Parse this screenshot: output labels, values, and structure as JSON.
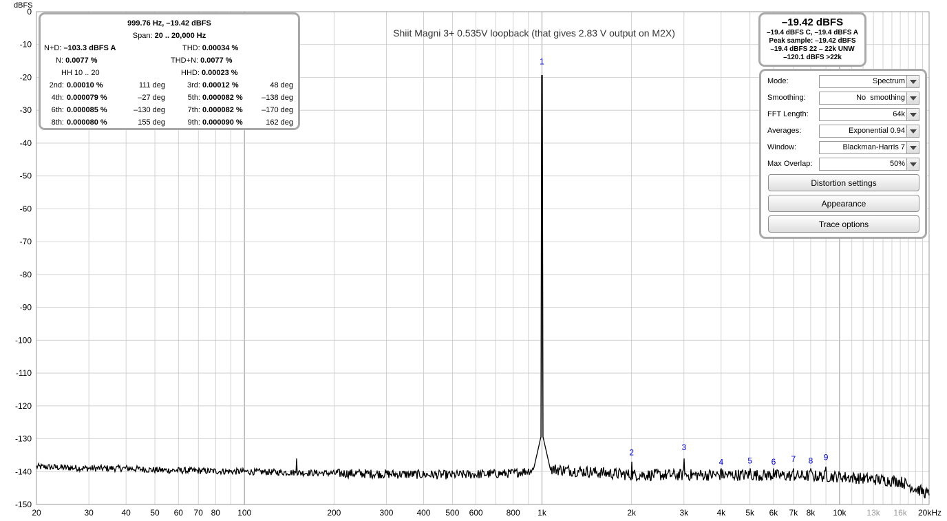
{
  "chart_data": {
    "type": "line",
    "title": "Shiit Magni 3+ 0.535V loopback (that gives 2.83 V output on M2X)",
    "ylabel": "dBFS",
    "xlabel": "",
    "xscale": "log",
    "xlim": [
      20,
      20000
    ],
    "ylim": [
      -150,
      0
    ],
    "grid": true,
    "y_ticks": [
      0,
      -10,
      -20,
      -30,
      -40,
      -50,
      -60,
      -70,
      -80,
      -90,
      -100,
      -110,
      -120,
      -130,
      -140,
      -150
    ],
    "x_ticks": [
      {
        "v": 20,
        "label": "20"
      },
      {
        "v": 30,
        "label": "30"
      },
      {
        "v": 40,
        "label": "40"
      },
      {
        "v": 50,
        "label": "50"
      },
      {
        "v": 60,
        "label": "60"
      },
      {
        "v": 70,
        "label": "70"
      },
      {
        "v": 80,
        "label": "80"
      },
      {
        "v": 100,
        "label": "100"
      },
      {
        "v": 200,
        "label": "200"
      },
      {
        "v": 300,
        "label": "300"
      },
      {
        "v": 400,
        "label": "400"
      },
      {
        "v": 500,
        "label": "500"
      },
      {
        "v": 600,
        "label": "600"
      },
      {
        "v": 800,
        "label": "800"
      },
      {
        "v": 1000,
        "label": "1k"
      },
      {
        "v": 2000,
        "label": "2k"
      },
      {
        "v": 3000,
        "label": "3k"
      },
      {
        "v": 4000,
        "label": "4k"
      },
      {
        "v": 5000,
        "label": "5k"
      },
      {
        "v": 6000,
        "label": "6k"
      },
      {
        "v": 7000,
        "label": "7k"
      },
      {
        "v": 8000,
        "label": "8k"
      },
      {
        "v": 10000,
        "label": "10k"
      },
      {
        "v": 13000,
        "label": "13k",
        "grey": true
      },
      {
        "v": 16000,
        "label": "16k",
        "grey": true
      },
      {
        "v": 20000,
        "label": "20kHz"
      }
    ],
    "noise_floor": [
      [
        20,
        -138.5
      ],
      [
        30,
        -139
      ],
      [
        40,
        -139
      ],
      [
        50,
        -139.5
      ],
      [
        100,
        -140
      ],
      [
        200,
        -140.5
      ],
      [
        500,
        -141
      ],
      [
        800,
        -140.5
      ],
      [
        1000,
        -139
      ],
      [
        2000,
        -141
      ],
      [
        5000,
        -141
      ],
      [
        10000,
        -141.5
      ],
      [
        16000,
        -143
      ],
      [
        20000,
        -147
      ]
    ],
    "peaks": [
      {
        "x": 150,
        "y": -136
      },
      {
        "x": 999.76,
        "y": -19.42
      },
      {
        "x": 2000,
        "y": -137
      },
      {
        "x": 3000,
        "y": -136
      },
      {
        "x": 4000,
        "y": -139
      },
      {
        "x": 5000,
        "y": -139
      },
      {
        "x": 6000,
        "y": -139
      },
      {
        "x": 7000,
        "y": -139
      },
      {
        "x": 8000,
        "y": -139
      },
      {
        "x": 9000,
        "y": -138.5
      }
    ],
    "harmonic_labels": [
      {
        "label": "1",
        "x": 1000,
        "y": -16
      },
      {
        "label": "2",
        "x": 2000,
        "y": -135
      },
      {
        "label": "3",
        "x": 3000,
        "y": -133.5
      },
      {
        "label": "4",
        "x": 4000,
        "y": -138
      },
      {
        "label": "5",
        "x": 5000,
        "y": -137.5
      },
      {
        "label": "6",
        "x": 6000,
        "y": -137.8
      },
      {
        "label": "7",
        "x": 7000,
        "y": -137
      },
      {
        "label": "8",
        "x": 8000,
        "y": -137.5
      },
      {
        "label": "9",
        "x": 9000,
        "y": -136.5
      }
    ]
  },
  "colors": {
    "grid": "#c8c8c8",
    "trace": "#000000",
    "harmonic": "#0000cc",
    "panel_border": "#a9a9a9"
  },
  "distortion": {
    "freq": "999.76 Hz, –19.42 dBFS",
    "span_label": "Span: ",
    "span": "20 .. 20,000 Hz",
    "nd_label": "N+D: ",
    "nd": "–103.3 dBFS A",
    "thd_label": "THD: ",
    "thd": "0.00034 %",
    "n_label": "N: ",
    "n": "0.0077 %",
    "thdn_label": "THD+N: ",
    "thdn": "0.0077 %",
    "hh": "HH 10 .. 20",
    "hhd_label": "HHD: ",
    "hhd": "0.00023 %",
    "harmonics": [
      {
        "n": "2nd:",
        "v": "0.00010 %",
        "deg": "111 deg",
        "n2": "3rd:",
        "v2": "0.00012 %",
        "deg2": "48 deg"
      },
      {
        "n": "4th:",
        "v": "0.000079 %",
        "deg": "–27 deg",
        "n2": "5th:",
        "v2": "0.000082 %",
        "deg2": "–138 deg"
      },
      {
        "n": "6th:",
        "v": "0.000085 %",
        "deg": "–130 deg",
        "n2": "7th:",
        "v2": "0.000082 %",
        "deg2": "–170 deg"
      },
      {
        "n": "8th:",
        "v": "0.000080 %",
        "deg": "155 deg",
        "n2": "9th:",
        "v2": "0.000090 %",
        "deg2": "162 deg"
      }
    ]
  },
  "level": {
    "main": "–19.42 dBFS",
    "line1": "–19.4 dBFS C, –19.4 dBFS A",
    "line2": "Peak sample: –19.42 dBFS",
    "line3": "–19.4 dBFS 22 – 22k UNW",
    "line4": "–120.1 dBFS >22k"
  },
  "controls": {
    "mode_label": "Mode:",
    "mode": "Spectrum",
    "smoothing_label": "Smoothing:",
    "smoothing": "No  smoothing",
    "fft_label": "FFT Length:",
    "fft": "64k",
    "averages_label": "Averages:",
    "averages": "Exponential 0.94",
    "window_label": "Window:",
    "window": "Blackman-Harris 7",
    "overlap_label": "Max Overlap:",
    "overlap": "50%",
    "btn_distortion": "Distortion settings",
    "btn_appearance": "Appearance",
    "btn_trace": "Trace options"
  }
}
